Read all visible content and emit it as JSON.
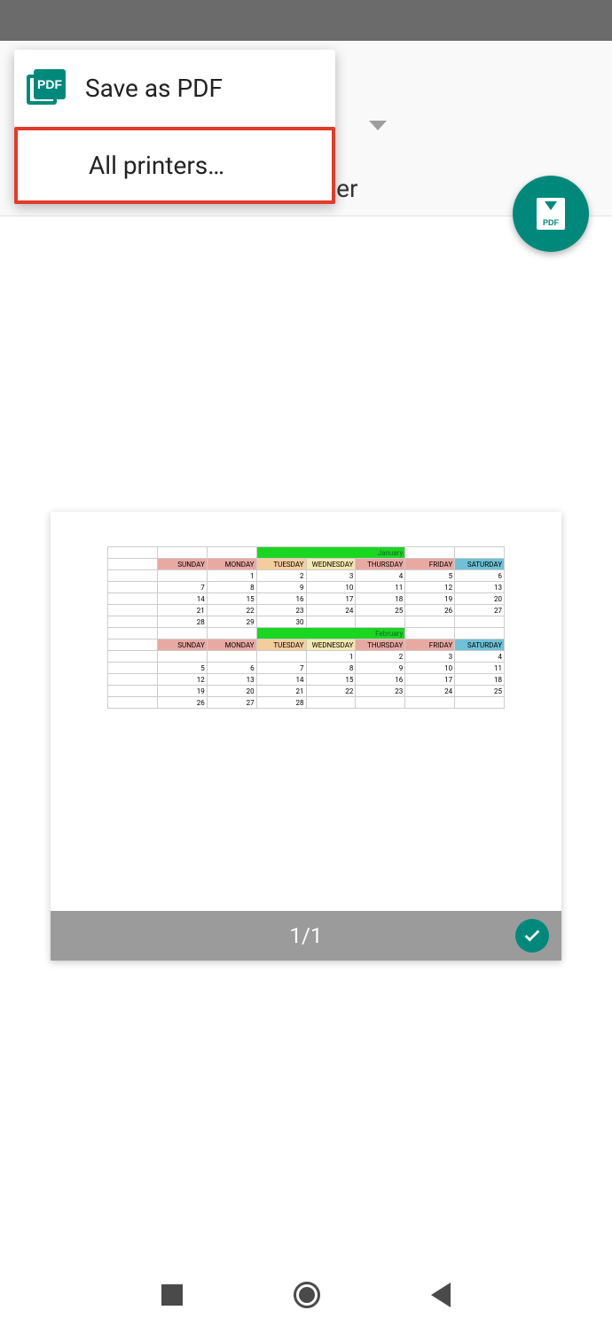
{
  "colors": {
    "accent": "#00897b",
    "highlight": "#e43a2a"
  },
  "header": {
    "partially_hidden_label": "ter"
  },
  "menu": {
    "items": [
      {
        "label": "Save as PDF",
        "icon": "pdf-icon"
      },
      {
        "label": "All printers…",
        "highlighted": true
      }
    ]
  },
  "fab": {
    "icon": "download-pdf-icon"
  },
  "preview": {
    "page_indicator": "1/1",
    "selected": true,
    "calendar": {
      "day_headers": [
        "SUNDAY",
        "MONDAY",
        "TUESDAY",
        "WEDNESDAY",
        "THURSDAY",
        "FRIDAY",
        "SATURDAY"
      ],
      "months": [
        {
          "name": "January",
          "weeks": [
            [
              "",
              "",
              "1",
              "2",
              "3",
              "4",
              "5",
              "6"
            ],
            [
              "",
              "7",
              "8",
              "9",
              "10",
              "11",
              "12",
              "13"
            ],
            [
              "",
              "14",
              "15",
              "16",
              "17",
              "18",
              "19",
              "20"
            ],
            [
              "",
              "21",
              "22",
              "23",
              "24",
              "25",
              "26",
              "27"
            ],
            [
              "",
              "28",
              "29",
              "30",
              "",
              "",
              "",
              ""
            ]
          ]
        },
        {
          "name": "February",
          "weeks": [
            [
              "",
              "",
              "",
              "",
              "1",
              "2",
              "3",
              "4"
            ],
            [
              "",
              "5",
              "6",
              "7",
              "8",
              "9",
              "10",
              "11"
            ],
            [
              "",
              "12",
              "13",
              "14",
              "15",
              "16",
              "17",
              "18"
            ],
            [
              "",
              "19",
              "20",
              "21",
              "22",
              "23",
              "24",
              "25"
            ],
            [
              "",
              "26",
              "27",
              "28",
              "",
              "",
              "",
              ""
            ]
          ]
        }
      ]
    }
  },
  "navbar": {
    "buttons": [
      "recent",
      "home",
      "back"
    ]
  }
}
